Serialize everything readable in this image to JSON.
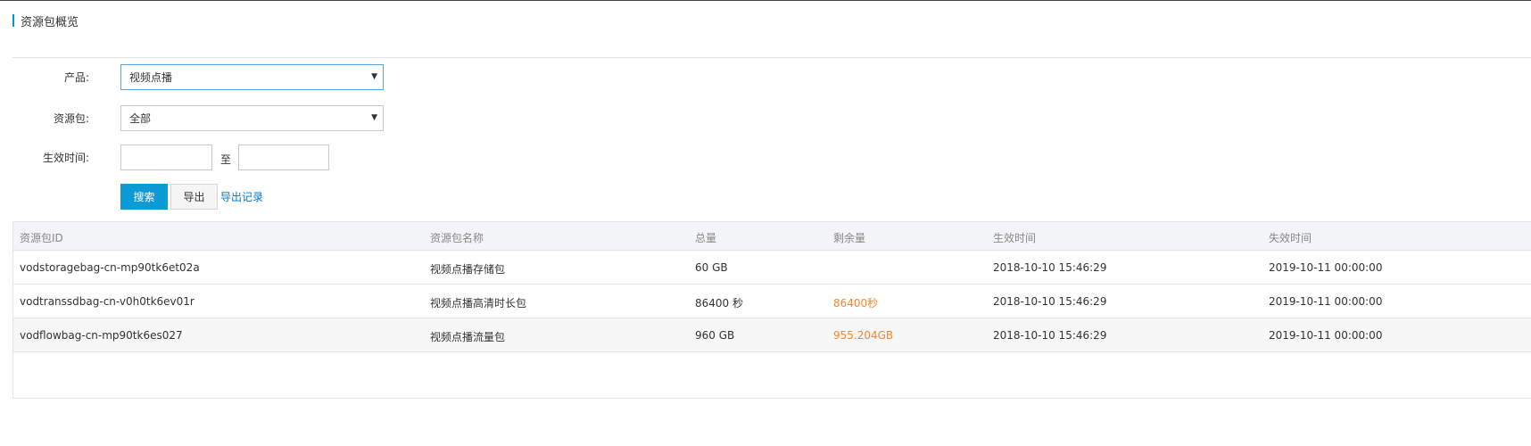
{
  "header": {
    "title": "资源包概览"
  },
  "form": {
    "product_label": "产品:",
    "product_value": "视频点播",
    "package_label": "资源包:",
    "package_value": "全部",
    "time_label": "生效时间:",
    "range_separator": "至",
    "start_value": "",
    "end_value": "",
    "search_button": "搜索",
    "export_button": "导出",
    "export_record_link": "导出记录"
  },
  "table": {
    "columns": [
      "资源包ID",
      "资源包名称",
      "总量",
      "剩余量",
      "生效时间",
      "失效时间"
    ],
    "rows": [
      {
        "id": "vodstoragebag-cn-mp90tk6et02a",
        "name": "视频点播存储包",
        "total": "60 GB",
        "remaining": "",
        "start": "2018-10-10 15:46:29",
        "end": "2019-10-11 00:00:00"
      },
      {
        "id": "vodtranssdbag-cn-v0h0tk6ev01r",
        "name": "视频点播高清时长包",
        "total": "86400 秒",
        "remaining": "86400秒",
        "start": "2018-10-10 15:46:29",
        "end": "2019-10-11 00:00:00"
      },
      {
        "id": "vodflowbag-cn-mp90tk6es027",
        "name": "视频点播流量包",
        "total": "960 GB",
        "remaining": "955.204GB",
        "start": "2018-10-10 15:46:29",
        "end": "2019-10-11 00:00:00"
      }
    ]
  },
  "colors": {
    "accent": "#0d9bd8",
    "link": "#0077c8",
    "warning": "#f5862e"
  },
  "icons": {
    "select_caret": "caret-down-icon"
  }
}
